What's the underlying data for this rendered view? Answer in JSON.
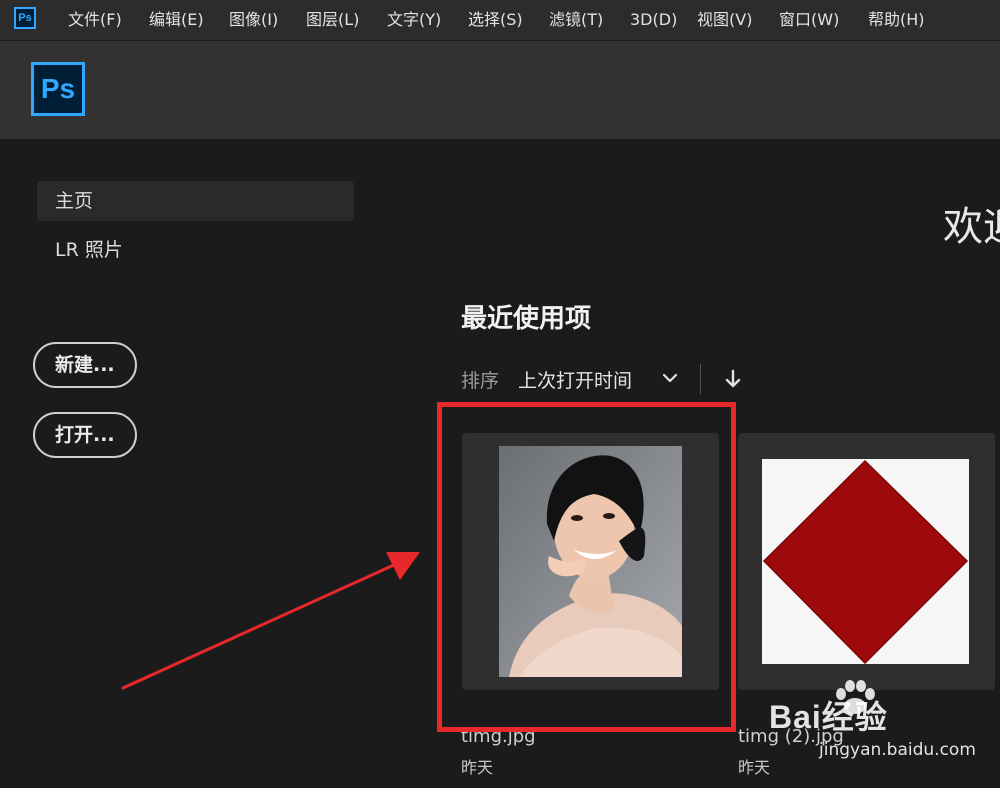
{
  "menubar": {
    "app_icon": "Ps",
    "items": [
      "文件(F)",
      "编辑(E)",
      "图像(I)",
      "图层(L)",
      "文字(Y)",
      "选择(S)",
      "滤镜(T)",
      "3D(D)",
      "视图(V)",
      "窗口(W)",
      "帮助(H)"
    ]
  },
  "header": {
    "logo": "Ps"
  },
  "sidebar": {
    "items": [
      {
        "label": "主页",
        "active": true
      },
      {
        "label": "LR 照片",
        "active": false
      }
    ],
    "new_button": "新建...",
    "open_button": "打开..."
  },
  "main": {
    "welcome": "欢迎",
    "recent_title": "最近使用项",
    "sort_label": "排序",
    "sort_value": "上次打开时间",
    "files": [
      {
        "name": "timg.jpg",
        "date": "昨天",
        "thumbnail": "portrait-photo"
      },
      {
        "name": "timg (2).jpg",
        "date": "昨天",
        "thumbnail": "red-diamond"
      }
    ]
  },
  "annotation": {
    "highlight_color": "#e8282b"
  },
  "watermark": {
    "main": "Bai经验",
    "sub": "jingyan.baidu.com"
  }
}
